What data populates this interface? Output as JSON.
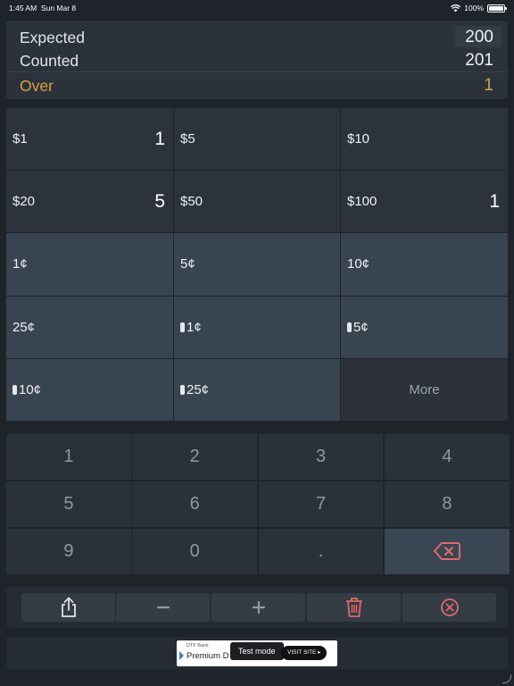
{
  "status": {
    "time": "1:45 AM",
    "date": "Sun Mar 8",
    "battery": "100%"
  },
  "summary": {
    "expected_label": "Expected",
    "expected_value": "200",
    "counted_label": "Counted",
    "counted_value": "201",
    "over_label": "Over",
    "over_value": "1"
  },
  "denominations": [
    {
      "label": "$1",
      "count": "1"
    },
    {
      "label": "$5",
      "count": ""
    },
    {
      "label": "$10",
      "count": ""
    },
    {
      "label": "$20",
      "count": "5"
    },
    {
      "label": "$50",
      "count": ""
    },
    {
      "label": "$100",
      "count": "1"
    },
    {
      "label": "1¢",
      "count": ""
    },
    {
      "label": "5¢",
      "count": ""
    },
    {
      "label": "10¢",
      "count": ""
    },
    {
      "label": "25¢",
      "count": ""
    },
    {
      "label": "1¢",
      "count": "",
      "roll": true
    },
    {
      "label": "5¢",
      "count": "",
      "roll": true
    },
    {
      "label": "10¢",
      "count": "",
      "roll": true
    },
    {
      "label": "25¢",
      "count": "",
      "roll": true
    },
    {
      "label": "More",
      "count": ""
    }
  ],
  "keypad": [
    "1",
    "2",
    "3",
    "4",
    "5",
    "6",
    "7",
    "8",
    "9",
    "0",
    "."
  ],
  "toolbar": {
    "icons": [
      "share-icon",
      "minus-icon",
      "plus-icon",
      "trash-icon",
      "clear-icon"
    ]
  },
  "colors": {
    "accent_over": "#d9a13b",
    "delete_red": "#e06a6a"
  },
  "ad": {
    "bank": "DTF Bank",
    "brand": "Premium D",
    "test_mode": "Test mode",
    "visit": "VISIT SITE"
  }
}
